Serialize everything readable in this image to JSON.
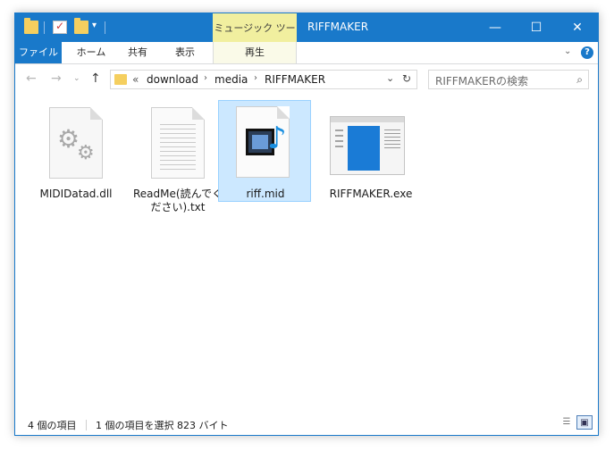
{
  "titlebar": {
    "context_tab": "ミュージック ツール",
    "title": "RIFFMAKER",
    "minimize": "—",
    "maximize": "☐",
    "close": "✕"
  },
  "ribbon": {
    "tabs": [
      "ファイル",
      "ホーム",
      "共有",
      "表示",
      "再生"
    ],
    "chevron": "⌄",
    "help": "?"
  },
  "navigation": {
    "back": "←",
    "forward": "→",
    "up": "↑",
    "breadcrumb_prefix": "«",
    "path": [
      "download",
      "media",
      "RIFFMAKER"
    ],
    "refresh": "↻"
  },
  "search": {
    "placeholder": "RIFFMAKERの検索"
  },
  "files": [
    {
      "name": "MIDIDatad.dll",
      "icon": "dll-gear-icon",
      "selected": false
    },
    {
      "name": "ReadMe(読んでください).txt",
      "icon": "text-document-icon",
      "selected": false
    },
    {
      "name": "riff.mid",
      "icon": "midi-audio-icon",
      "selected": true
    },
    {
      "name": "RIFFMAKER.exe",
      "icon": "application-exe-icon",
      "selected": false
    }
  ],
  "status": {
    "item_count": "4 個の項目",
    "selection": "1 個の項目を選択  823 バイト"
  },
  "colors": {
    "accent": "#1979ca",
    "context_tab": "#f1ef9f",
    "selection": "#cce8ff"
  }
}
